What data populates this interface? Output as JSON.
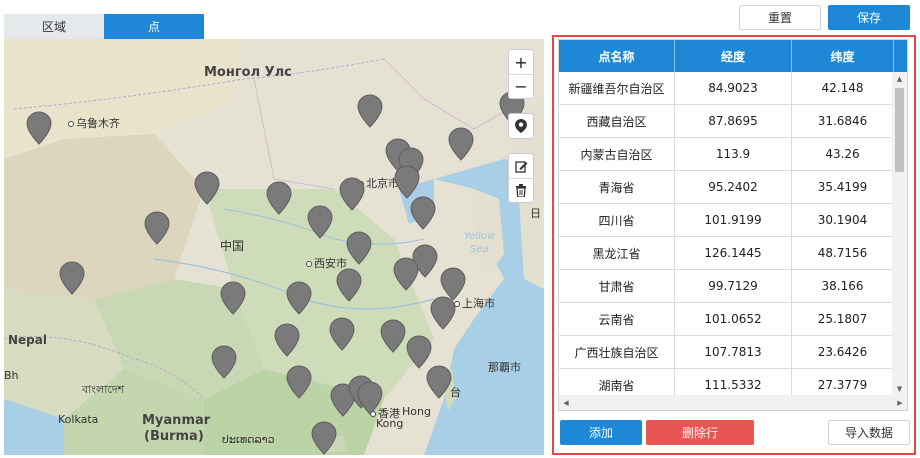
{
  "tabs": [
    {
      "label": "区域",
      "active": false
    },
    {
      "label": "点",
      "active": true
    }
  ],
  "toolbar": {
    "reset_label": "重置",
    "save_label": "保存"
  },
  "map": {
    "zoom_in": "+",
    "zoom_out": "−",
    "labels": {
      "mongolia": "Монгол Улс",
      "urumqi": "乌鲁木齐",
      "beijing": "北京市",
      "china": "中国",
      "xian": "西安市",
      "shanghai": "上海市",
      "nepal": "Nepal",
      "bangladesh": "বাংলাদেশ",
      "myanmar1": "Myanmar",
      "myanmar2": "(Burma)",
      "kolkata": "Kolkata",
      "laos": "ປະເທດລາວ",
      "hongkong_cn": "香港",
      "hongkong_en1": "Hong",
      "hongkong_en2": "Kong",
      "naha": "那覇市",
      "yellow1": "Yellow",
      "yellow2": "Sea",
      "taiwan": "台",
      "bhutan": "Bh",
      "japan": "日"
    },
    "icons": {
      "zoom_in": "plus-icon",
      "zoom_out": "minus-icon",
      "marker": "map-pin-icon",
      "edit": "edit-icon",
      "delete": "trash-icon"
    }
  },
  "table": {
    "headers": [
      "点名称",
      "经度",
      "纬度"
    ],
    "rows": [
      [
        "新疆维吾尔自治区",
        "84.9023",
        "42.148"
      ],
      [
        "西藏自治区",
        "87.8695",
        "31.6846"
      ],
      [
        "内蒙古自治区",
        "113.9",
        "43.26"
      ],
      [
        "青海省",
        "95.2402",
        "35.4199"
      ],
      [
        "四川省",
        "101.9199",
        "30.1904"
      ],
      [
        "黑龙江省",
        "126.1445",
        "48.7156"
      ],
      [
        "甘肃省",
        "99.7129",
        "38.166"
      ],
      [
        "云南省",
        "101.0652",
        "25.1807"
      ],
      [
        "广西壮族自治区",
        "107.7813",
        "23.6426"
      ],
      [
        "湖南省",
        "111.5332",
        "27.3779"
      ]
    ]
  },
  "actions": {
    "add_label": "添加",
    "delete_row_label": "删除行",
    "import_label": "导入数据"
  },
  "colors": {
    "accent": "#1e88d7",
    "danger": "#e85555",
    "panel_border": "#e84646",
    "pin": "#7a7a7a"
  }
}
